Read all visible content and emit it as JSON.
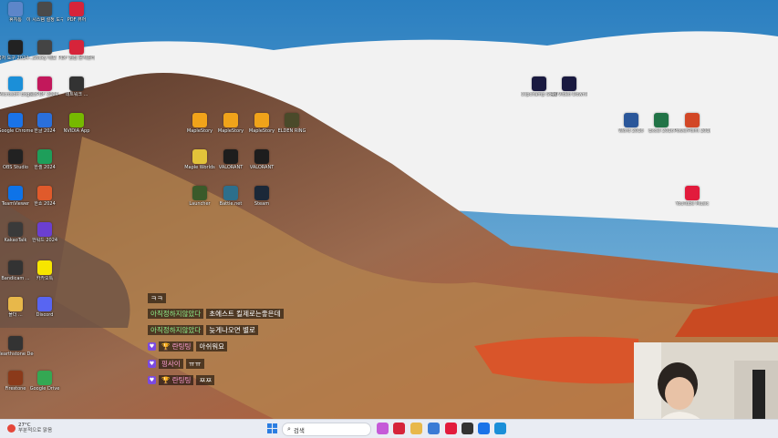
{
  "desktop_icons": [
    {
      "id": "recycle",
      "label": "휴지통",
      "icon": "recycle-bin-icon",
      "color": "#5d86c9"
    },
    {
      "id": "dev-tools",
      "label": "이 시스템 설정 도구...",
      "icon": "gear-icon",
      "color": "#4a4a4a"
    },
    {
      "id": "pdf-viewer",
      "label": "PDF 뷰어",
      "icon": "pdf-icon",
      "color": "#d6243a"
    },
    {
      "id": "screenshot",
      "label": "캡처 도구 2024-...",
      "icon": "window-icon",
      "color": "#222"
    },
    {
      "id": "sticky",
      "label": "Sticky 메모",
      "icon": "note-icon",
      "color": "#444"
    },
    {
      "id": "pdf-merge",
      "label": "PDF 편집 문서관리",
      "icon": "pdf-icon",
      "color": "#d6243a"
    },
    {
      "id": "edge",
      "label": "Microsoft Edge",
      "icon": "edge-icon",
      "color": "#1b8fd8"
    },
    {
      "id": "ezpdf",
      "label": "ezPDF 2024",
      "icon": "pdf-icon",
      "color": "#c2185b"
    },
    {
      "id": "network",
      "label": "네트워크 ...",
      "icon": "network-icon",
      "color": "#333"
    },
    {
      "id": "chrome",
      "label": "Google Chrome",
      "icon": "chrome-icon",
      "color": "#1a73e8"
    },
    {
      "id": "hwp",
      "label": "한글 2024",
      "icon": "document-icon",
      "color": "#2a6fdb"
    },
    {
      "id": "nvidia",
      "label": "NVIDIA App",
      "icon": "nvidia-icon",
      "color": "#76b900"
    },
    {
      "id": "obs",
      "label": "OBS Studio",
      "icon": "obs-icon",
      "color": "#222"
    },
    {
      "id": "hancell",
      "label": "한셀 2024",
      "icon": "spreadsheet-icon",
      "color": "#1e9e5a"
    },
    {
      "id": "teamviewer",
      "label": "TeamViewer",
      "icon": "teamviewer-icon",
      "color": "#0e73e8"
    },
    {
      "id": "hanshow",
      "label": "한쇼 2024",
      "icon": "presentation-icon",
      "color": "#e05a2b"
    },
    {
      "id": "kakaotalk",
      "label": "KakaoTalk",
      "icon": "kakao-icon",
      "color": "#3a3a3a"
    },
    {
      "id": "hword",
      "label": "한워드 2024",
      "icon": "word-icon",
      "color": "#6b3fd1"
    },
    {
      "id": "bandicam",
      "label": "Bandicam ...",
      "icon": "camera-icon",
      "color": "#333"
    },
    {
      "id": "kakao",
      "label": "카카오톡",
      "icon": "chat-icon",
      "color": "#f7e600"
    },
    {
      "id": "folder",
      "label": "폴더 ...",
      "icon": "folder-icon",
      "color": "#e8b84a"
    },
    {
      "id": "discord",
      "label": "Discord",
      "icon": "discord-icon",
      "color": "#5865f2"
    },
    {
      "id": "hearthstone",
      "label": "Hearthstone Deck Tracker",
      "icon": "tracker-icon",
      "color": "#333"
    },
    {
      "id": "firestone",
      "label": "Firestone",
      "icon": "flame-icon",
      "color": "#8b3a1a"
    },
    {
      "id": "gdrive",
      "label": "Google Drive",
      "icon": "drive-icon",
      "color": "#34a853"
    },
    {
      "id": "maplestory1",
      "label": "MapleStory",
      "icon": "maple-icon",
      "color": "#f0a31a"
    },
    {
      "id": "maplestory2",
      "label": "MapleStory",
      "icon": "maple-icon",
      "color": "#f0a31a"
    },
    {
      "id": "maplestory3",
      "label": "MapleStory",
      "icon": "maple-icon",
      "color": "#f0a31a"
    },
    {
      "id": "eldenring",
      "label": "ELDEN RING",
      "icon": "game-icon",
      "color": "#4a4a2a"
    },
    {
      "id": "maple-worlds",
      "label": "Maple Worlds",
      "icon": "game-icon",
      "color": "#e2c33a"
    },
    {
      "id": "valorant",
      "label": "VALORANT",
      "icon": "valorant-icon",
      "color": "#1d1d1d"
    },
    {
      "id": "valorant2",
      "label": "VALORANT",
      "icon": "valorant-icon",
      "color": "#1d1d1d"
    },
    {
      "id": "app-x",
      "label": "Launcher",
      "icon": "game-icon",
      "color": "#3a5a2a"
    },
    {
      "id": "app-y",
      "label": "Battle.net",
      "icon": "game-icon",
      "color": "#2d6f8c"
    },
    {
      "id": "steam",
      "label": "Steam",
      "icon": "steam-icon",
      "color": "#1b2838"
    },
    {
      "id": "clipchamp",
      "label": "Clipchamp Studio",
      "icon": "play-icon",
      "color": "#1a1a40"
    },
    {
      "id": "clip4k",
      "label": "4K Video Downloader",
      "icon": "video-icon",
      "color": "#1a1a40"
    },
    {
      "id": "word",
      "label": "Word 2016",
      "icon": "word-icon",
      "color": "#2b579a"
    },
    {
      "id": "excel",
      "label": "Excel 2016",
      "icon": "excel-icon",
      "color": "#217346"
    },
    {
      "id": "ppt",
      "label": "PowerPoint 2016",
      "icon": "powerpoint-icon",
      "color": "#d24726"
    },
    {
      "id": "ytmusic",
      "label": "YouTube Music",
      "icon": "music-icon",
      "color": "#e21b3c"
    }
  ],
  "chat": [
    {
      "nick": "",
      "message": "ㅋㅋ",
      "pink": false
    },
    {
      "nick": "아직정하지않았다",
      "message": "초에스트 킬제로는좋은데",
      "pink": false
    },
    {
      "nick": "아직정하지않았다",
      "message": "늦게나오면 별로",
      "pink": false
    },
    {
      "nick": "🏆 란팅팅",
      "message": "아쉬워요",
      "pink": true
    },
    {
      "nick": "핑사이",
      "message": "ㅠㅠ",
      "pink": true
    },
    {
      "nick": "🏆 란팅팅",
      "message": "ㅉㅉ",
      "pink": true
    }
  ],
  "taskbar": {
    "weather_temp": "27°C",
    "weather_desc": "부분적으로 맑음",
    "search_placeholder": "검색",
    "apps": [
      {
        "name": "start-icon",
        "color": "#2a7de1"
      },
      {
        "name": "taskview-icon",
        "color": "#333"
      },
      {
        "name": "copilot-icon",
        "color": "#c55ad8"
      },
      {
        "name": "ezpdf-icon",
        "color": "#d6243a"
      },
      {
        "name": "explorer-icon",
        "color": "#e8b84a"
      },
      {
        "name": "store-icon",
        "color": "#3a7bd5"
      },
      {
        "name": "ytmusic-icon",
        "color": "#e21b3c"
      },
      {
        "name": "obs-icon",
        "color": "#333"
      },
      {
        "name": "chrome-icon",
        "color": "#1a73e8"
      },
      {
        "name": "edge-icon",
        "color": "#1b8fd8"
      }
    ]
  }
}
